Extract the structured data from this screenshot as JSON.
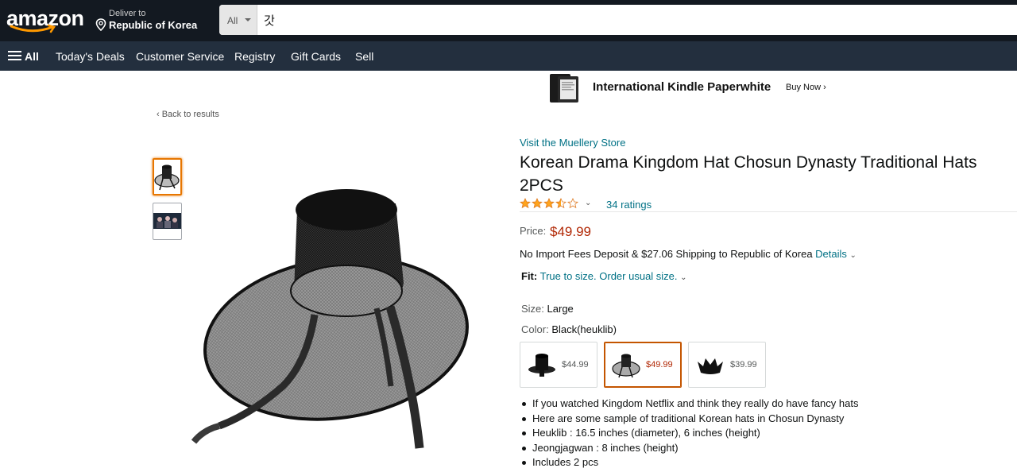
{
  "header": {
    "logo_text": "amazon",
    "deliver_to_label": "Deliver to",
    "deliver_to_location": "Republic of Korea",
    "search_category": "All",
    "search_query": "갓"
  },
  "nav": {
    "all_label": "All",
    "items": [
      "Today's Deals",
      "Customer Service",
      "Registry",
      "Gift Cards",
      "Sell"
    ]
  },
  "ad": {
    "title": "International Kindle Paperwhite",
    "cta": "Buy Now ›"
  },
  "back_link": "‹ Back to results",
  "product": {
    "store_link": "Visit the Muellery Store",
    "title": "Korean Drama Kingdom Hat Chosun Dynasty Traditional Hats 2PCS",
    "rating_stars": 3.5,
    "ratings_count": "34 ratings",
    "price_label": "Price:",
    "price": "$49.99",
    "shipping_text": "No Import Fees Deposit & $27.06 Shipping to Republic of Korea",
    "shipping_details": "Details",
    "fit_label": "Fit:",
    "fit_text": "True to size. Order usual size.",
    "size_label": "Size:",
    "size_value": "Large",
    "color_label": "Color:",
    "color_value": "Black(heuklib)",
    "variants": [
      {
        "price": "$44.99",
        "selected": false
      },
      {
        "price": "$49.99",
        "selected": true
      },
      {
        "price": "$39.99",
        "selected": false
      }
    ],
    "bullets": [
      "If you watched Kingdom Netflix and think they really do have fancy hats",
      "Here are some sample of traditional Korean hats in Chosun Dynasty",
      "Heuklib : 16.5 inches (diameter), 6 inches (height)",
      "Jeongjagwan : 8 inches (height)",
      "Includes 2 pcs"
    ]
  },
  "colors": {
    "nav_top": "#131921",
    "nav_bottom": "#232f3e",
    "link": "#007185",
    "price": "#b12704",
    "star": "#ffa41c",
    "active_border": "#e77600"
  }
}
